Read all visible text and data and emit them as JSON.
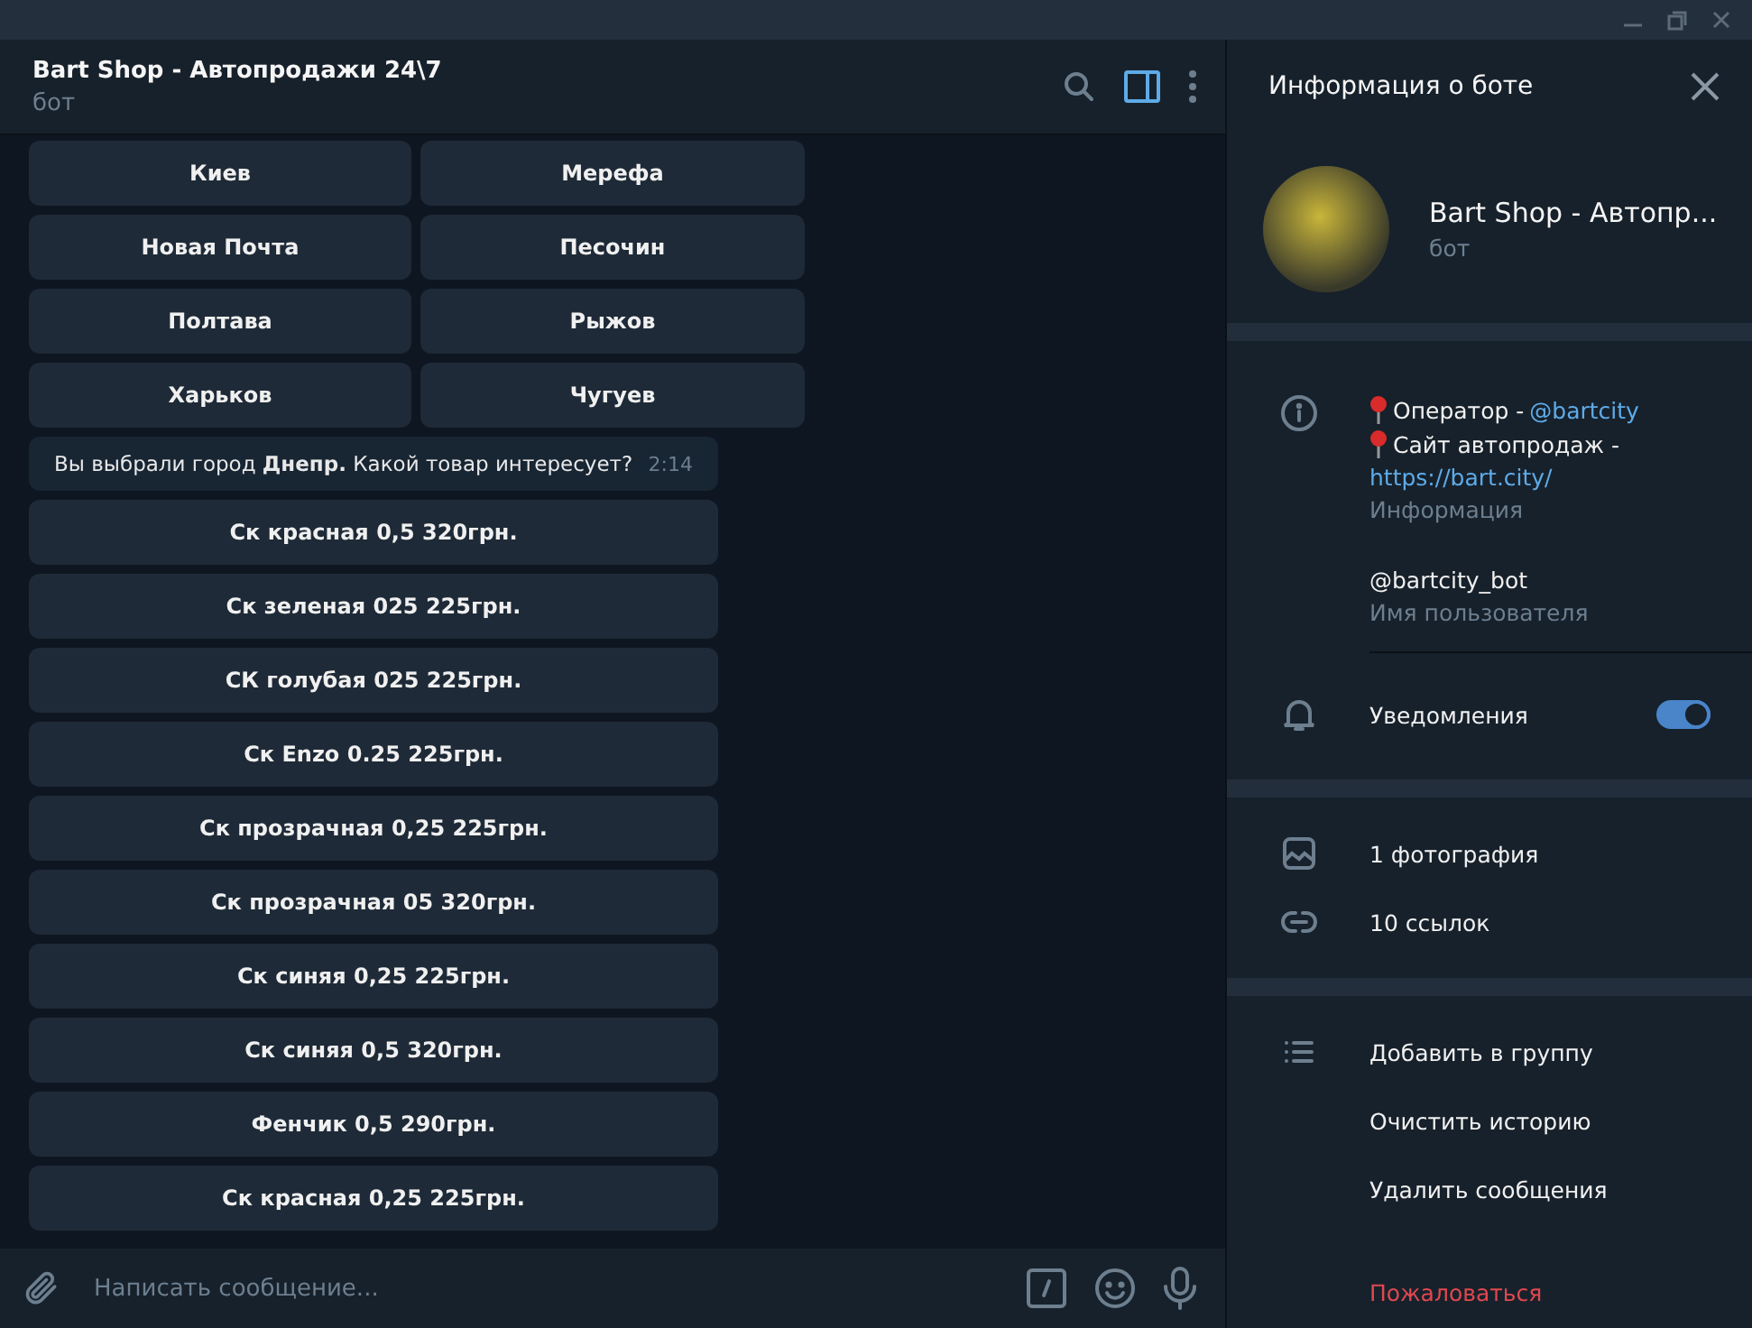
{
  "chat": {
    "title": "Bart Shop - Автопродажи 24\\7",
    "subtitle": "бот",
    "city_buttons": [
      "Киев",
      "Мерефа",
      "Новая Почта",
      "Песочин",
      "Полтава",
      "Рыжов",
      "Харьков",
      "Чугуев"
    ],
    "message": {
      "text": "Вы выбрали город **Днепр.** Какой товар интересует?",
      "time": "2:14"
    },
    "product_buttons": [
      "Ск красная 0,5 320грн.",
      "Ск зеленая 025 225грн.",
      "СК голубая 025 225грн.",
      "Ск Enzo 0.25 225грн.",
      "Ск прозрачная 0,25 225грн.",
      "Ск прозрачная 05 320грн.",
      "Ск синяя 0,25 225грн.",
      "Ск синяя 0,5 320грн.",
      "Фенчик 0,5 290грн.",
      "Ск красная 0,25 225грн."
    ],
    "input": {
      "placeholder": "Написать сообщение..."
    }
  },
  "info_panel": {
    "title": "Информация о боте",
    "name": "Bart Shop - Автопр...",
    "subtitle": "бот",
    "description": {
      "operator_label": "Оператор - ",
      "operator_link": "@bartcity",
      "site_label": "Сайт автопродаж -",
      "site_link": "https://bart.city/"
    },
    "description_caption": "Информация",
    "username": "@bartcity_bot",
    "username_caption": "Имя пользователя",
    "notifications": {
      "label": "Уведомления",
      "on": true
    },
    "media": [
      {
        "kind": "photo",
        "label": "1 фотография"
      },
      {
        "kind": "link",
        "label": "10 ссылок"
      }
    ],
    "actions": [
      {
        "label": "Добавить в группу",
        "danger": false
      },
      {
        "label": "Очистить историю",
        "danger": false
      },
      {
        "label": "Удалить сообщения",
        "danger": false
      },
      {
        "label": "Пожаловаться",
        "danger": true
      }
    ]
  }
}
